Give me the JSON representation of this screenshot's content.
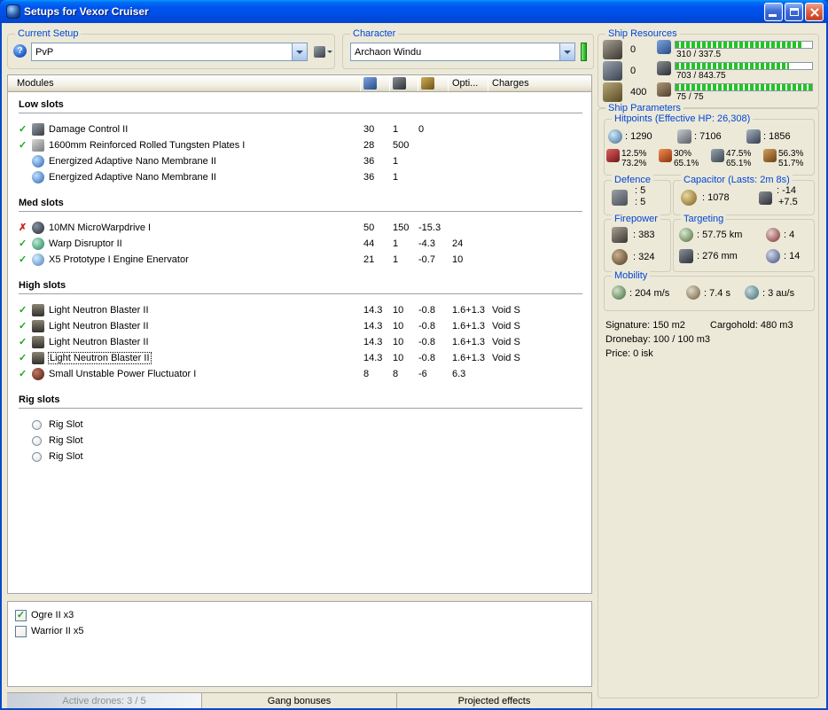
{
  "window": {
    "title": "Setups for Vexor Cruiser"
  },
  "setup": {
    "label": "Current Setup",
    "value": "PvP",
    "help_glyph": "?"
  },
  "character": {
    "label": "Character",
    "value": "Archaon Windu"
  },
  "modules": {
    "columns": {
      "modules": "Modules",
      "opti": "Opti...",
      "charges": "Charges"
    },
    "status_glyphs": {
      "on": "✓",
      "off": "✗"
    },
    "sections": [
      {
        "title": "Low slots",
        "rows": [
          {
            "status": "on",
            "icon": "damage-control",
            "name": "Damage Control II",
            "cpu": "30",
            "pg": "1",
            "cap": "0",
            "opti": "",
            "charge": ""
          },
          {
            "status": "on",
            "icon": "armor-plate",
            "name": "1600mm Reinforced Rolled Tungsten Plates I",
            "cpu": "28",
            "pg": "500",
            "cap": "",
            "opti": "",
            "charge": ""
          },
          {
            "status": "none",
            "icon": "membrane",
            "name": "Energized Adaptive Nano Membrane II",
            "cpu": "36",
            "pg": "1",
            "cap": "",
            "opti": "",
            "charge": ""
          },
          {
            "status": "none",
            "icon": "membrane",
            "name": "Energized Adaptive Nano Membrane II",
            "cpu": "36",
            "pg": "1",
            "cap": "",
            "opti": "",
            "charge": ""
          }
        ]
      },
      {
        "title": "Med slots",
        "rows": [
          {
            "status": "off",
            "icon": "mwd",
            "name": "10MN MicroWarpdrive I",
            "cpu": "50",
            "pg": "150",
            "cap": "-15.3",
            "opti": "",
            "charge": ""
          },
          {
            "status": "on",
            "icon": "warp-disruptor",
            "name": "Warp Disruptor II",
            "cpu": "44",
            "pg": "1",
            "cap": "-4.3",
            "opti": "24",
            "charge": ""
          },
          {
            "status": "on",
            "icon": "stasis-web",
            "name": "X5 Prototype I Engine Enervator",
            "cpu": "21",
            "pg": "1",
            "cap": "-0.7",
            "opti": "10",
            "charge": ""
          }
        ]
      },
      {
        "title": "High slots",
        "rows": [
          {
            "status": "on",
            "icon": "blaster",
            "name": "Light Neutron Blaster II",
            "cpu": "14.3",
            "pg": "10",
            "cap": "-0.8",
            "opti": "1.6+1.3",
            "charge": "Void S"
          },
          {
            "status": "on",
            "icon": "blaster",
            "name": "Light Neutron Blaster II",
            "cpu": "14.3",
            "pg": "10",
            "cap": "-0.8",
            "opti": "1.6+1.3",
            "charge": "Void S"
          },
          {
            "status": "on",
            "icon": "blaster",
            "name": "Light Neutron Blaster II",
            "cpu": "14.3",
            "pg": "10",
            "cap": "-0.8",
            "opti": "1.6+1.3",
            "charge": "Void S"
          },
          {
            "status": "on",
            "icon": "blaster",
            "name": "Light Neutron Blaster II",
            "cpu": "14.3",
            "pg": "10",
            "cap": "-0.8",
            "opti": "1.6+1.3",
            "charge": "Void S",
            "selected": true
          },
          {
            "status": "on",
            "icon": "neut",
            "name": "Small Unstable Power Fluctuator I",
            "cpu": "8",
            "pg": "8",
            "cap": "-6",
            "opti": "6.3",
            "charge": ""
          }
        ]
      },
      {
        "title": "Rig slots",
        "rows": [
          {
            "status": "none",
            "icon": "rig",
            "name": "Rig Slot",
            "cpu": "",
            "pg": "",
            "cap": "",
            "opti": "",
            "charge": ""
          },
          {
            "status": "none",
            "icon": "rig",
            "name": "Rig Slot",
            "cpu": "",
            "pg": "",
            "cap": "",
            "opti": "",
            "charge": ""
          },
          {
            "status": "none",
            "icon": "rig",
            "name": "Rig Slot",
            "cpu": "",
            "pg": "",
            "cap": "",
            "opti": "",
            "charge": ""
          }
        ]
      }
    ]
  },
  "drones": {
    "check_glyph": "✓",
    "items": [
      {
        "checked": true,
        "name": "Ogre II x3"
      },
      {
        "checked": false,
        "name": "Warrior II x5"
      }
    ]
  },
  "statusbar": {
    "active_drones": "Active drones: 3 / 5",
    "gang_bonuses": "Gang bonuses",
    "projected_effects": "Projected effects"
  },
  "resources": {
    "label": "Ship Resources",
    "turrets": "0",
    "launchers": "0",
    "calibration": "400",
    "bars": [
      {
        "icon": "cpu",
        "text": "310 / 337.5",
        "fill": 0.92
      },
      {
        "icon": "powergrid",
        "text": "703 / 843.75",
        "fill": 0.83
      },
      {
        "icon": "drone-bandwidth",
        "text": "75 / 75",
        "fill": 1
      }
    ]
  },
  "parameters": {
    "label": "Ship Parameters",
    "hitpoints": {
      "label": "Hitpoints (Effective HP: 26,308)",
      "shield": ": 1290",
      "armor": ": 7106",
      "structure": ": 1856",
      "resists": [
        {
          "icon": "em",
          "top": "12.5%",
          "bottom": "73.2%"
        },
        {
          "icon": "thermal",
          "top": "30%",
          "bottom": "65.1%"
        },
        {
          "icon": "kinetic",
          "top": "47.5%",
          "bottom": "65.1%"
        },
        {
          "icon": "explosive",
          "top": "56.3%",
          "bottom": "51.7%"
        }
      ]
    },
    "defence": {
      "label": "Defence",
      "top": ": 5",
      "bottom": ": 5"
    },
    "capacitor": {
      "label": "Capacitor (Lasts: 2m 8s)",
      "amount": ": 1078",
      "delta_top": ": -14",
      "delta_bottom": "+7.5"
    },
    "firepower": {
      "label": "Firepower",
      "volley": ": 383",
      "dps": ": 324"
    },
    "targeting": {
      "label": "Targeting",
      "range": ": 57.75 km",
      "max_targets": ": 4",
      "scan_res": ": 276 mm",
      "sensor_strength": ": 14"
    },
    "mobility": {
      "label": "Mobility",
      "speed": ": 204 m/s",
      "align": ": 7.4 s",
      "warp": ": 3 au/s"
    },
    "signature": "Signature: 150 m2",
    "cargohold": "Cargohold: 480 m3",
    "dronebay": "Dronebay: 100 / 100 m3",
    "price": "Price: 0 isk"
  }
}
